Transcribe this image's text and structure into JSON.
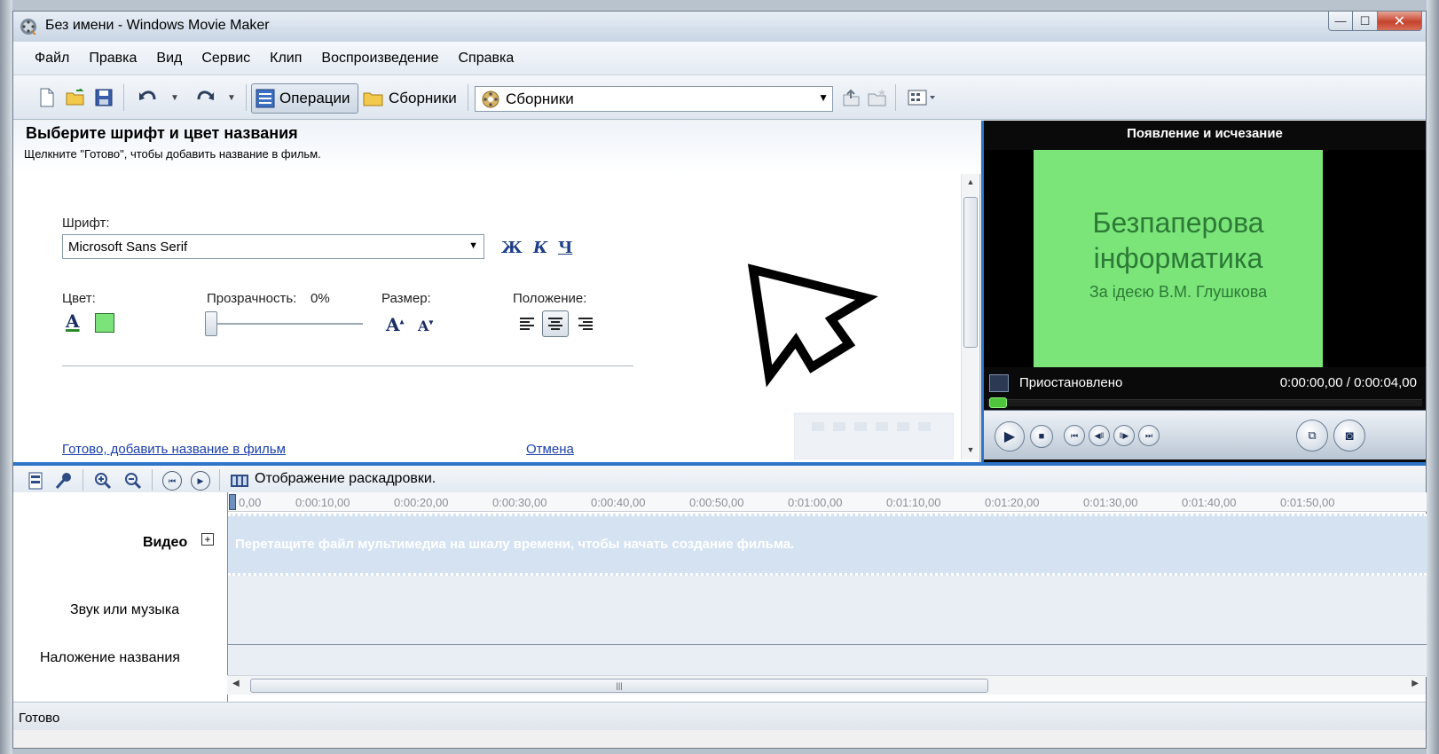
{
  "window": {
    "title": "Без имени - Windows Movie Maker",
    "controls": {
      "minimize": "—",
      "maximize": "☐",
      "close": "✕"
    }
  },
  "menu": [
    "Файл",
    "Правка",
    "Вид",
    "Сервис",
    "Клип",
    "Воспроизведение",
    "Справка"
  ],
  "toolbar": {
    "tasks_label": "Операции",
    "collections_label": "Сборники",
    "collections_dropdown": "Сборники"
  },
  "task_pane": {
    "title": "Выберите шрифт и цвет названия",
    "subtitle": "Щелкните \"Готово\", чтобы добавить название в фильм.",
    "font_label": "Шрифт:",
    "font_value": "Microsoft Sans Serif",
    "bold": "Ж",
    "italic": "К",
    "underline": "Ч",
    "color_label": "Цвет:",
    "color_letter": "A",
    "swatch_color": "#7ce37b",
    "transparency_label": "Прозрачность:",
    "transparency_value": "0%",
    "size_label": "Размер:",
    "size_up": "A",
    "size_down": "A",
    "position_label": "Положение:",
    "done_link": "Готово, добавить название в фильм",
    "cancel_link": "Отмена"
  },
  "preview": {
    "title": "Появление и исчезание",
    "line1": "Безпаперова",
    "line2": "інформатика",
    "line3": "За ідеєю В.М. Глушкова",
    "status": "Приостановлено",
    "time": "0:00:00,00 / 0:00:04,00"
  },
  "timeline": {
    "view_label": "Отображение раскадровки.",
    "ruler": [
      "0,00",
      "0:00:10,00",
      "0:00:20,00",
      "0:00:30,00",
      "0:00:40,00",
      "0:00:50,00",
      "0:01:00,00",
      "0:01:10,00",
      "0:01:20,00",
      "0:01:30,00",
      "0:01:40,00",
      "0:01:50,00"
    ],
    "tracks": {
      "video": "Видео",
      "audio": "Звук или музыка",
      "title_overlay": "Наложение названия"
    },
    "video_hint": "Перетащите файл мультимедиа на шкалу времени, чтобы начать создание фильма."
  },
  "statusbar": {
    "text": "Готово"
  }
}
